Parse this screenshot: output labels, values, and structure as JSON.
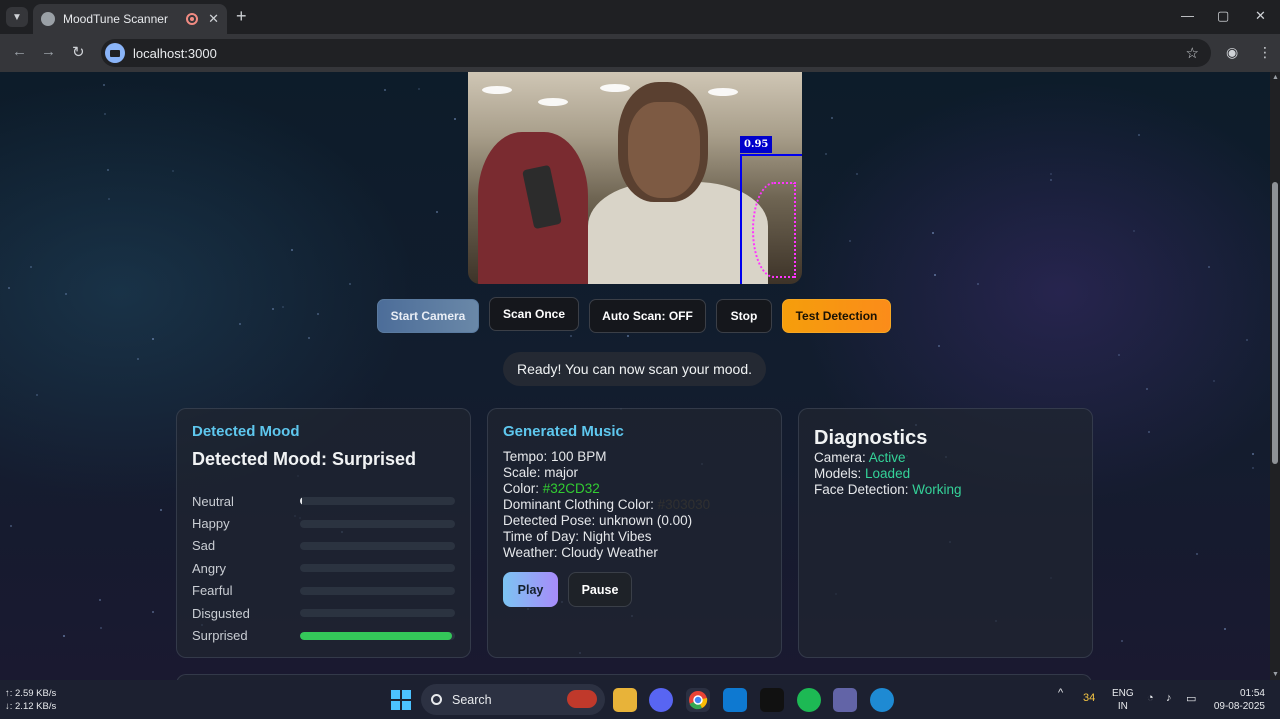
{
  "browser": {
    "tab_title": "MoodTune Scanner",
    "url": "localhost:3000",
    "new_tab": "+",
    "tab_close": "✕",
    "minimize": "—",
    "maximize": "▢",
    "close": "✕"
  },
  "video": {
    "detection_score": "0.95"
  },
  "controls": {
    "start_camera": "Start Camera",
    "scan_once": "Scan Once",
    "auto_scan": "Auto Scan: OFF",
    "stop": "Stop",
    "test_detection": "Test Detection"
  },
  "status": "Ready! You can now scan your mood.",
  "mood_card": {
    "heading": "Detected Mood",
    "result": "Detected Mood: Surprised",
    "rows": [
      {
        "label": "Neutral",
        "value": 0.01
      },
      {
        "label": "Happy",
        "value": 0
      },
      {
        "label": "Sad",
        "value": 0
      },
      {
        "label": "Angry",
        "value": 0
      },
      {
        "label": "Fearful",
        "value": 0
      },
      {
        "label": "Disgusted",
        "value": 0
      },
      {
        "label": "Surprised",
        "value": 0.98
      }
    ],
    "fill_color": "#34c759"
  },
  "music_card": {
    "heading": "Generated Music",
    "tempo": "Tempo: 100 BPM",
    "scale": "Scale: major",
    "color_label": "Color: ",
    "color_value": "#32CD32",
    "clothing_label": "Dominant Clothing Color: ",
    "clothing_value": "#303030",
    "pose": "Detected Pose: unknown (0.00)",
    "time_of_day": "Time of Day: Night Vibes",
    "weather": "Weather: Cloudy Weather",
    "play": "Play",
    "pause": "Pause"
  },
  "diagnostics": {
    "heading": "Diagnostics",
    "camera_label": "Camera: ",
    "camera_value": "Active",
    "models_label": "Models: ",
    "models_value": "Loaded",
    "face_label": "Face Detection: ",
    "face_value": "Working"
  },
  "taskbar": {
    "net_up": "↑: 2.59 KB/s",
    "net_down": "↓: 2.12 KB/s",
    "search": "Search",
    "temperature": "34",
    "lang_1": "ENG",
    "lang_2": "IN",
    "time": "01:54",
    "date": "09-08-2025"
  }
}
